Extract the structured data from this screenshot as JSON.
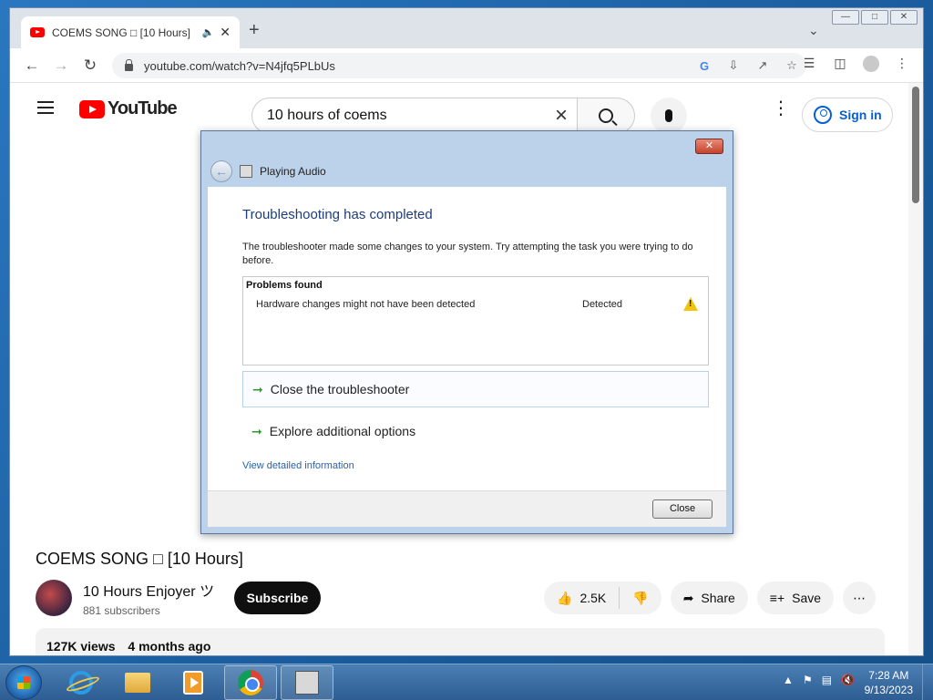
{
  "browser": {
    "tab_title": "COEMS SONG □ [10 Hours]",
    "url": "youtube.com/watch?v=N4jfq5PLbUs"
  },
  "youtube": {
    "logo_text": "YouTube",
    "search_query": "10 hours of coems",
    "sign_in_label": "Sign in",
    "video_title": "COEMS SONG □ [10 Hours]",
    "channel_name": "10 Hours Enjoyer ツ",
    "subscribers": "881 subscribers",
    "subscribe_label": "Subscribe",
    "likes": "2.5K",
    "share_label": "Share",
    "save_label": "Save",
    "views": "127K views",
    "upload_age": "4 months ago"
  },
  "dialog": {
    "window_title": "Playing Audio",
    "heading": "Troubleshooting has completed",
    "message": "The troubleshooter made some changes to your system. Try attempting the task you were trying to do before.",
    "problems_header": "Problems found",
    "problems": [
      {
        "name": "Hardware changes might not have been detected",
        "status": "Detected"
      }
    ],
    "option_close": "Close the troubleshooter",
    "option_explore": "Explore additional options",
    "detail_link": "View detailed information",
    "close_button": "Close"
  },
  "taskbar": {
    "time": "7:28 AM",
    "date": "9/13/2023"
  }
}
